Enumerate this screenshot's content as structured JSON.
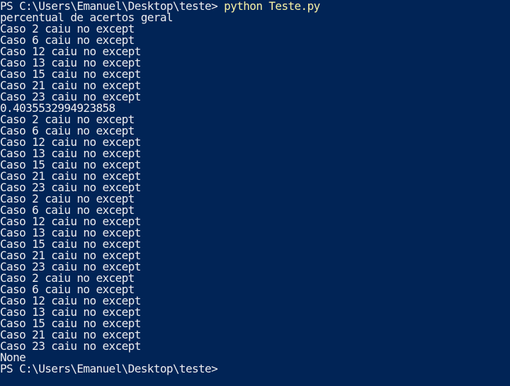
{
  "terminal": {
    "prompt": "PS C:\\Users\\Emanuel\\Desktop\\teste> ",
    "command": "python Teste.py",
    "output": [
      "percentual de acertos geral",
      "Caso 2 caiu no except",
      "Caso 6 caiu no except",
      "Caso 12 caiu no except",
      "Caso 13 caiu no except",
      "Caso 15 caiu no except",
      "Caso 21 caiu no except",
      "Caso 23 caiu no except",
      "0.4035532994923858",
      "Caso 2 caiu no except",
      "Caso 6 caiu no except",
      "Caso 12 caiu no except",
      "Caso 13 caiu no except",
      "Caso 15 caiu no except",
      "Caso 21 caiu no except",
      "Caso 23 caiu no except",
      "Caso 2 caiu no except",
      "Caso 6 caiu no except",
      "Caso 12 caiu no except",
      "Caso 13 caiu no except",
      "Caso 15 caiu no except",
      "Caso 21 caiu no except",
      "Caso 23 caiu no except",
      "Caso 2 caiu no except",
      "Caso 6 caiu no except",
      "Caso 12 caiu no except",
      "Caso 13 caiu no except",
      "Caso 15 caiu no except",
      "Caso 21 caiu no except",
      "Caso 23 caiu no except",
      "None"
    ],
    "final_prompt": "PS C:\\Users\\Emanuel\\Desktop\\teste>"
  },
  "colors": {
    "background": "#012456",
    "text": "#EEEDF0",
    "command": "#F9F1A5"
  }
}
